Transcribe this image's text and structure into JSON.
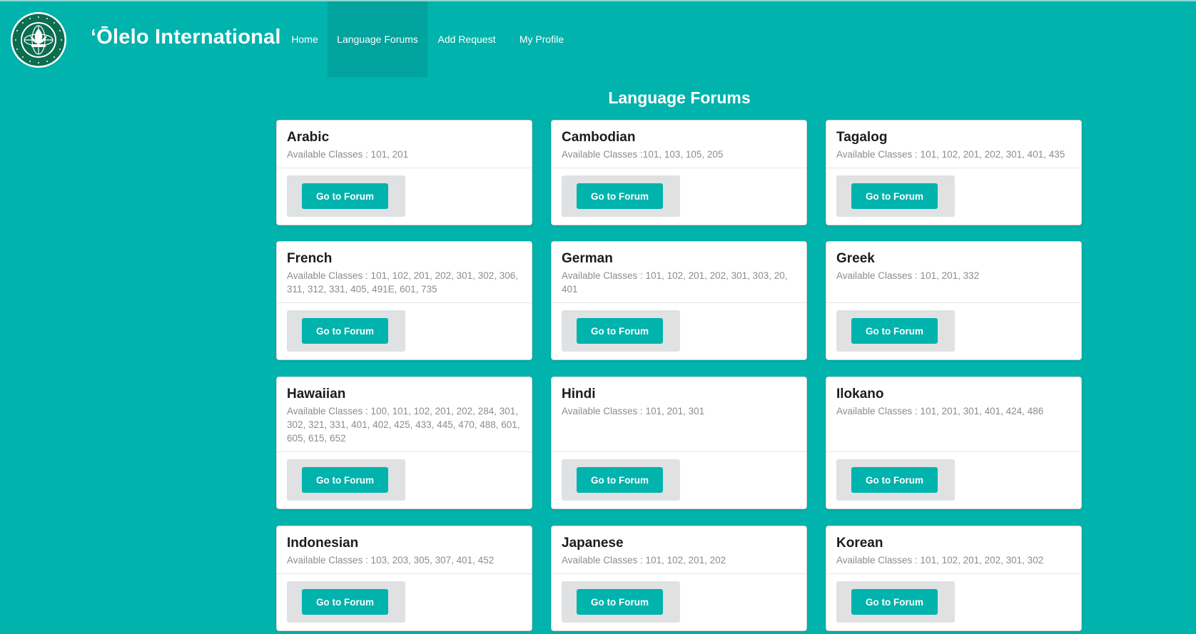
{
  "colors": {
    "brand_teal": "#00B3AD",
    "active_nav": "#00A39D",
    "button_bg": "#00B3AD",
    "card_extra_bg": "#e0e1e2"
  },
  "header": {
    "brand": "ʻŌlelo International",
    "logo_icon": "university-of-hawaii-seal-icon",
    "nav": [
      {
        "label": "Home",
        "active": false
      },
      {
        "label": "Language Forums",
        "active": true
      },
      {
        "label": "Add Request",
        "active": false
      },
      {
        "label": "My Profile",
        "active": false
      }
    ]
  },
  "main": {
    "title": "Language Forums",
    "button_label": "Go to Forum",
    "forums": [
      {
        "name": "Arabic",
        "classes": "Available Classes : 101, 201"
      },
      {
        "name": "Cambodian",
        "classes": "Available Classes :101, 103, 105, 205"
      },
      {
        "name": "Tagalog",
        "classes": "Available Classes : 101, 102, 201, 202, 301, 401, 435"
      },
      {
        "name": "French",
        "classes": "Available Classes : 101, 102, 201, 202, 301, 302, 306, 311, 312, 331, 405, 491E, 601, 735"
      },
      {
        "name": "German",
        "classes": "Available Classes : 101, 102, 201, 202, 301, 303, 20, 401"
      },
      {
        "name": "Greek",
        "classes": "Available Classes : 101, 201, 332"
      },
      {
        "name": "Hawaiian",
        "classes": "Available Classes : 100, 101, 102, 201, 202, 284, 301, 302, 321, 331, 401, 402, 425, 433, 445, 470, 488, 601, 605, 615, 652"
      },
      {
        "name": "Hindi",
        "classes": "Available Classes : 101, 201, 301"
      },
      {
        "name": "Ilokano",
        "classes": "Available Classes : 101, 201, 301, 401, 424, 486"
      },
      {
        "name": "Indonesian",
        "classes": "Available Classes : 103, 203, 305, 307, 401, 452"
      },
      {
        "name": "Japanese",
        "classes": "Available Classes : 101, 102, 201, 202"
      },
      {
        "name": "Korean",
        "classes": "Available Classes : 101, 102, 201, 202, 301, 302"
      }
    ]
  }
}
